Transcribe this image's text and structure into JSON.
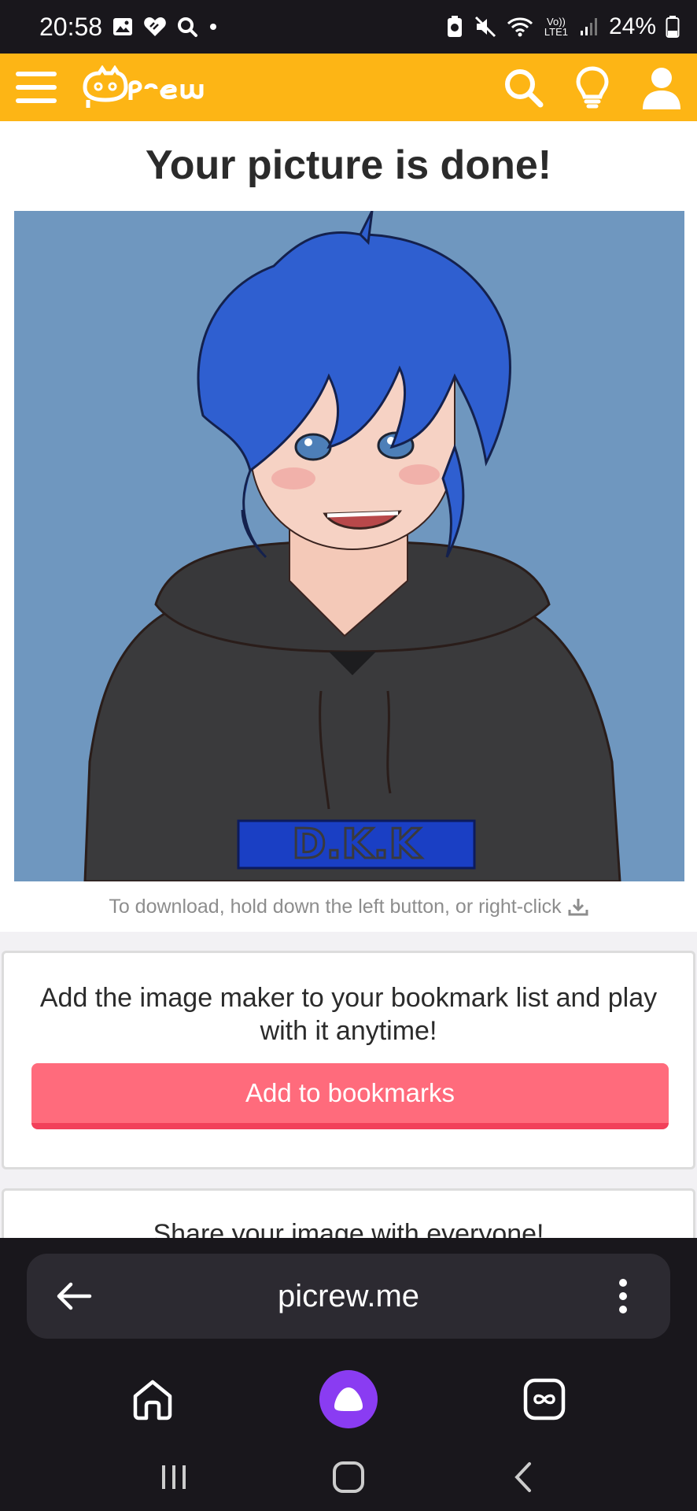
{
  "status_bar": {
    "time": "20:58",
    "battery_percent": "24%",
    "network_label": "Vo)) LTE1"
  },
  "header": {
    "logo_text": "Picrew",
    "accent_color": "#fdb515"
  },
  "main": {
    "title": "Your picture is done!",
    "image": {
      "shirt_text": "D.K.K",
      "background_color": "#6f97bf"
    },
    "download_hint": "To download, hold down the left button, or right-click"
  },
  "bookmark_card": {
    "text": "Add the image maker to your bookmark list and play with it anytime!",
    "button_label": "Add to bookmarks",
    "button_color": "#ff6b7c"
  },
  "share_card": {
    "title": "Share your image with everyone!"
  },
  "browser": {
    "url": "picrew.me",
    "back_icon": "arrow-left-icon",
    "menu_icon": "more-vertical-icon"
  },
  "bottom_nav": {
    "items": [
      "home-icon",
      "alice-assistant-icon",
      "tabs-icon"
    ]
  },
  "system_nav": {
    "items": [
      "recents-icon",
      "home-circle-icon",
      "back-chevron-icon"
    ]
  }
}
